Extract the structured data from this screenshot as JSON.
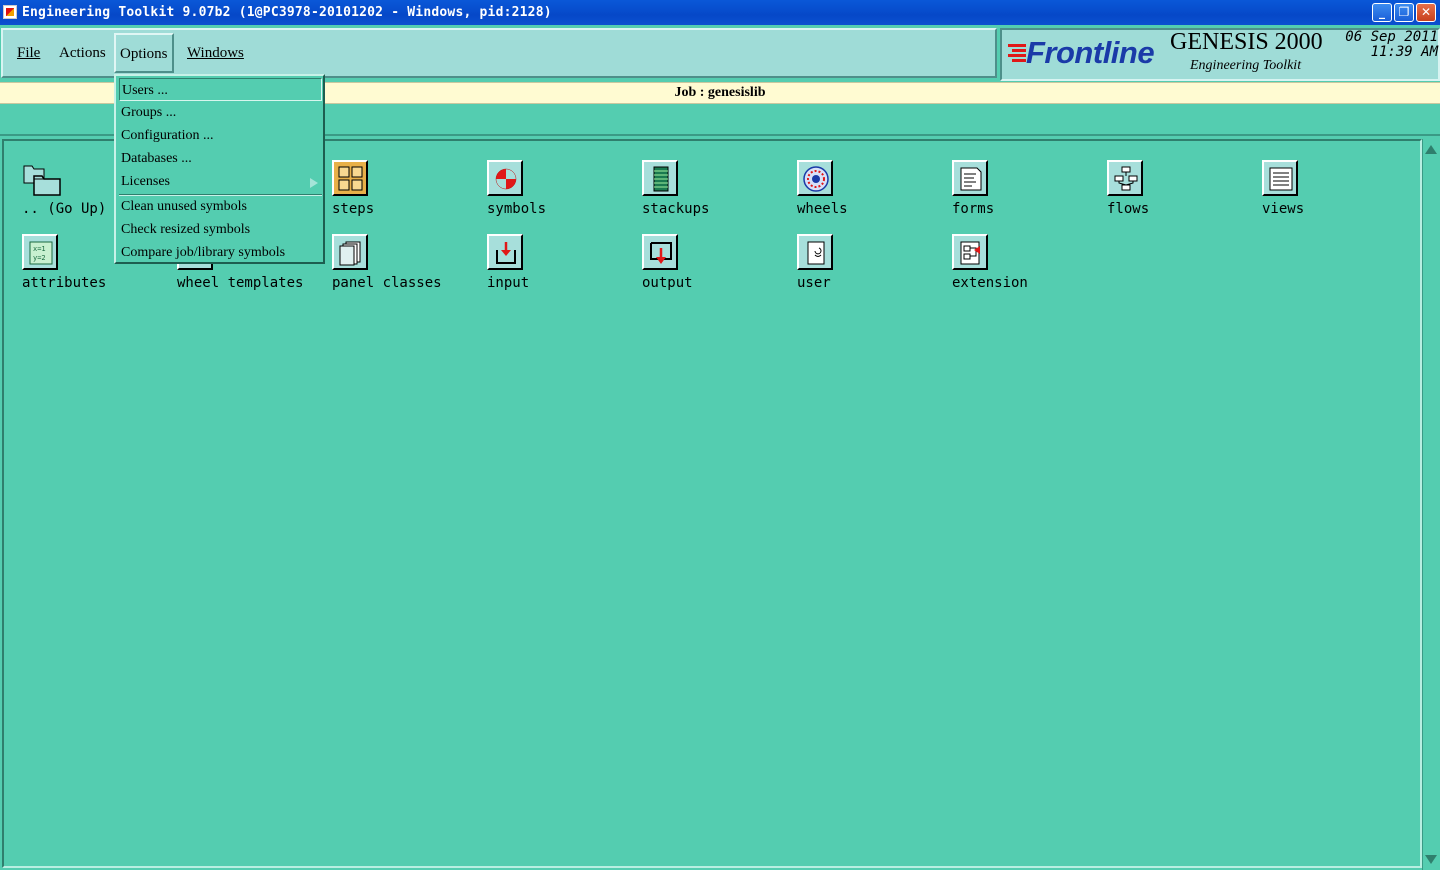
{
  "window": {
    "title": "Engineering Toolkit 9.07b2 (1@PC3978-20101202 - Windows, pid:2128)",
    "controls": {
      "minimize": "_",
      "maximize": "❐",
      "close": "✕"
    }
  },
  "menubar": {
    "file": "File",
    "actions": "Actions",
    "options": "Options",
    "windows": "Windows"
  },
  "brand": {
    "frontline": "Frontline",
    "product": "GENESIS 2000",
    "subtitle": "Engineering Toolkit",
    "date": "06 Sep 2011",
    "time": "11:39 AM"
  },
  "job": {
    "label": "Job : genesislib"
  },
  "options_menu": {
    "items": [
      "Users ...",
      "Groups ...",
      "Configuration ...",
      "Databases ...",
      "Licenses",
      "Clean unused symbols",
      "Check resized symbols",
      "Compare job/library symbols"
    ]
  },
  "entities": [
    {
      "label": ".. (Go Up)",
      "icon": "folder-up-icon"
    },
    {
      "label": "",
      "icon": "matrix-icon"
    },
    {
      "label": "steps",
      "icon": "steps-icon"
    },
    {
      "label": "symbols",
      "icon": "symbols-icon"
    },
    {
      "label": "stackups",
      "icon": "stackups-icon"
    },
    {
      "label": "wheels",
      "icon": "wheels-icon"
    },
    {
      "label": "forms",
      "icon": "forms-icon"
    },
    {
      "label": "flows",
      "icon": "flows-icon"
    },
    {
      "label": "views",
      "icon": "views-icon"
    },
    {
      "label": "attributes",
      "icon": "attributes-icon"
    },
    {
      "label": "wheel templates",
      "icon": "wheel-templates-icon"
    },
    {
      "label": "panel classes",
      "icon": "panel-classes-icon"
    },
    {
      "label": "input",
      "icon": "input-icon"
    },
    {
      "label": "output",
      "icon": "output-icon"
    },
    {
      "label": "user",
      "icon": "user-icon"
    },
    {
      "label": "extension",
      "icon": "extension-icon"
    }
  ],
  "colors": {
    "background": "#54cdb0",
    "menubar": "#9fdcd7",
    "job_bar": "#fffbd2",
    "title_bar": "#0a58d8",
    "brand_blue": "#1a3aa8",
    "brand_red": "#e01818"
  }
}
